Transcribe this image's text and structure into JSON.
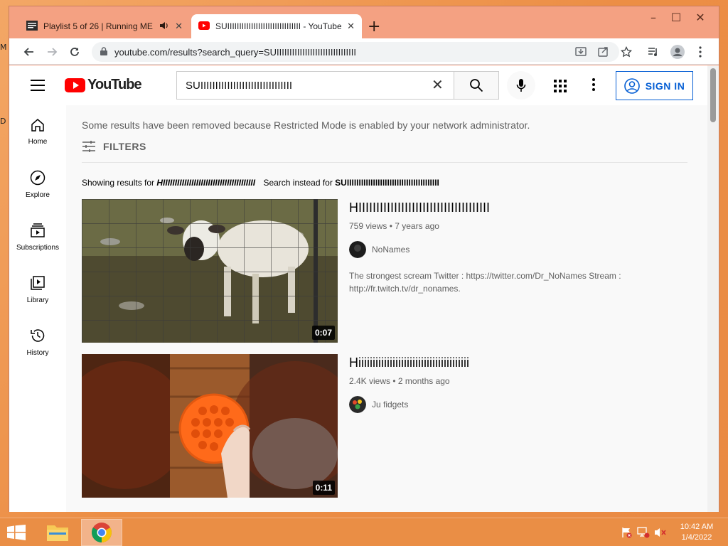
{
  "desktop": {
    "sliver_top": "M",
    "sliver_mid": "D"
  },
  "browser": {
    "tabs": [
      {
        "label": "Playlist 5 of 26 | Running ME",
        "close": "✕"
      },
      {
        "label": "SUIIIIIIIIIIIIIIIIIIIIIIIIIIIIIII - YouTube",
        "close": "✕"
      }
    ],
    "new_tab": "+",
    "url": "youtube.com/results?search_query=SUIIIIIIIIIIIIIIIIIIIIIIIIIIIIIII",
    "window_controls": {
      "minimize": "–",
      "maximize": "☐",
      "close": "✕"
    }
  },
  "youtube": {
    "logo_text": "YouTube",
    "search_value": "SUIIIIIIIIIIIIIIIIIIIIIIIIIIIIIII",
    "sign_in": "SIGN IN",
    "guide": [
      {
        "label": "Home",
        "icon": "home-icon"
      },
      {
        "label": "Explore",
        "icon": "compass-icon"
      },
      {
        "label": "Subscriptions",
        "icon": "subscriptions-icon"
      },
      {
        "label": "Library",
        "icon": "library-icon"
      },
      {
        "label": "History",
        "icon": "history-icon"
      }
    ],
    "notice": "Some results have been removed because Restricted Mode is enabled by your network administrator.",
    "filters": "FILTERS",
    "showing_prefix": "Showing results for",
    "showing_query": "HIIIIIIIIIIIIIIIIIIIIIIIIIIIIIIIIIIIIIII",
    "instead_prefix": "Search instead for",
    "instead_query": "SUIIIIIIIIIIIIIIIIIIIIIIIIIIIIIIIIIIIIIII",
    "videos": [
      {
        "title": "HIIIIIIIIIIIIIIIIIIIIIIIIIIIIIIIIIIIII",
        "stats": "759 views • 7 years ago",
        "channel": "NoNames",
        "description": "The strongest scream Twitter : https://twitter.com/Dr_NoNames Stream : http://fr.twitch.tv/dr_nonames.",
        "duration": "0:07"
      },
      {
        "title": "Hiiiiiiiiiiiiiiiiiiiiiiiiiiiiiiiiiiiiiii",
        "stats": "2.4K views • 2 months ago",
        "channel": "Ju fidgets",
        "description": "",
        "duration": "0:11"
      }
    ]
  },
  "taskbar": {
    "time": "10:42 AM",
    "date": "1/4/2022"
  },
  "colors": {
    "accent_blue": "#065fd4",
    "yt_red": "#ff0000",
    "chrome_frame": "#f4a182",
    "desktop": "#ec8e45"
  }
}
